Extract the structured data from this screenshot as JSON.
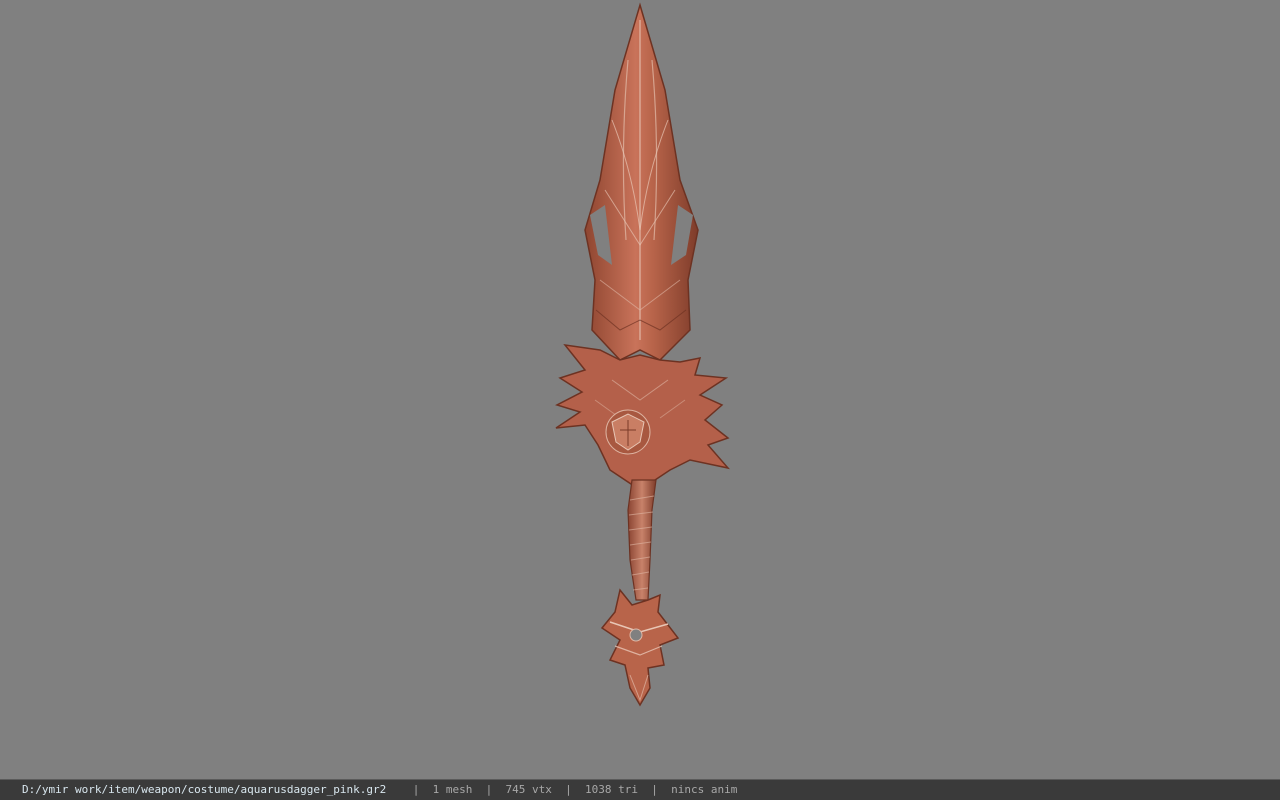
{
  "statusbar": {
    "file_path": "D:/ymir work/item/weapon/costume/aquarusdagger_pink.gr2",
    "mesh_count": "1 mesh",
    "vertex_count": "745 vtx",
    "triangle_count": "1038 tri",
    "anim_status": "nincs anim",
    "separator": "|"
  },
  "colors": {
    "viewport_background": "#808080",
    "model_primary": "#b8644a",
    "model_highlight": "#e0b8a6",
    "model_shadow": "#7a3a28",
    "statusbar_background": "#3a3a3a"
  }
}
